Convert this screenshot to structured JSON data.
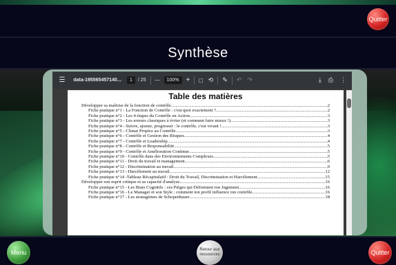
{
  "header": {
    "quit_label": "Quitter"
  },
  "title": "Synthèse",
  "viewer": {
    "filename": "data-195565457140...",
    "page_current": "1",
    "page_total": "/ 25",
    "zoom": "100%",
    "zoom_minus": "—",
    "zoom_plus": "+",
    "icons": [
      "menu-icon",
      "fit-page-icon",
      "rotate-icon",
      "annotate-icon",
      "undo-icon",
      "redo-icon",
      "download-icon",
      "print-icon",
      "more-icon"
    ]
  },
  "document": {
    "heading": "Table des matières",
    "entries": [
      {
        "level": 0,
        "text": "Développer sa maîtrise de la fonction de contrôle",
        "page": "2"
      },
      {
        "level": 1,
        "text": "Fiche pratique n°1 - La Fonction de Contrôle : c'est quoi exactement ?",
        "page": "2"
      },
      {
        "level": 1,
        "text": "Fiche pratique n°2 - Les 4 étapes du Contrôle en Action",
        "page": "3"
      },
      {
        "level": 1,
        "text": "Fiche pratique n°3 - Les erreurs classiques à éviter (et comment faire mieux !)",
        "page": "3"
      },
      {
        "level": 1,
        "text": "Fiche pratique n°4 - Suivre, ajuster, progresser : le contrôle, c'est vivant !",
        "page": "3"
      },
      {
        "level": 1,
        "text": "Fiche pratique n°5 - Climat Propice au Contrôle",
        "page": "3"
      },
      {
        "level": 1,
        "text": "Fiche pratique n°6 - Contrôle et Gestion des Risques",
        "page": "4"
      },
      {
        "level": 1,
        "text": "Fiche pratique n°7 - Contrôle et Leadership",
        "page": "4"
      },
      {
        "level": 1,
        "text": "Fiche pratique n°8 - Contrôle et Responsabilité",
        "page": "5"
      },
      {
        "level": 1,
        "text": "Fiche pratique n°9 - Contrôle et Amélioration Continue",
        "page": "5"
      },
      {
        "level": 1,
        "text": "Fiche pratique n°10 - Contrôle dans des Environnements Complexes",
        "page": "5"
      },
      {
        "level": 1,
        "text": "Fiche pratique n°11 - Droit du travail et management",
        "page": "6"
      },
      {
        "level": 1,
        "text": "Fiche pratique n°12 - Discrimination au travail",
        "page": "9"
      },
      {
        "level": 1,
        "text": "Fiche pratique n°13 - Harcèlement au travail",
        "page": "12"
      },
      {
        "level": 1,
        "text": "Fiche pratique n°14 -Tableau Récapitulatif : Droit du Travail, Discrimination et Harcèlement",
        "page": "15"
      },
      {
        "level": 0,
        "text": "Développer son esprit critique et sa capacité d'analyse",
        "page": "16"
      },
      {
        "level": 1,
        "text": "Fiche pratique n°15 - Les Biais Cognitifs : ces Pièges qui Déforment ton Jugement",
        "page": "16"
      },
      {
        "level": 1,
        "text": "Fiche pratique n°16 - Le Manager et son Style : comment ton profil influence ton contrôle",
        "page": "16"
      },
      {
        "level": 1,
        "text": "Fiche pratique n°17 - Les stratagèmes de Schopenhauer",
        "page": "18"
      }
    ]
  },
  "footer": {
    "menu_label": "Menu",
    "back_label": "Retour aux ressources",
    "quit_label": "Quitter"
  },
  "colors": {
    "quit": "#d32222",
    "menu": "#3c9a3a",
    "back": "#cfcfcf",
    "bar": "#06071b"
  }
}
